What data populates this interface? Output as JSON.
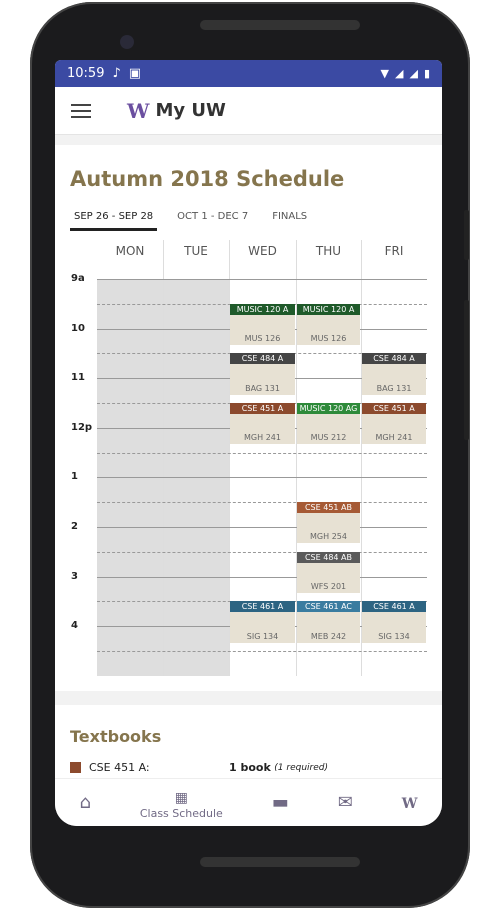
{
  "status": {
    "time": "10:59"
  },
  "app": {
    "title": "My UW",
    "logo": "W"
  },
  "schedule": {
    "title": "Autumn 2018 Schedule",
    "tabs": [
      {
        "label": "SEP 26 - SEP 28",
        "active": true
      },
      {
        "label": "OCT 1 - DEC 7",
        "active": false
      },
      {
        "label": "FINALS",
        "active": false
      }
    ],
    "days": [
      "MON",
      "TUE",
      "WED",
      "THU",
      "FRI"
    ],
    "hours": [
      "9a",
      "10",
      "11",
      "12p",
      "1",
      "2",
      "3",
      "4"
    ],
    "events": [
      {
        "day": 2,
        "start": 9.5,
        "end": 10.33,
        "name": "MUSIC 120 A",
        "loc": "MUS 126",
        "color": "#1f5a2a"
      },
      {
        "day": 3,
        "start": 9.5,
        "end": 10.33,
        "name": "MUSIC 120 A",
        "loc": "MUS 126",
        "color": "#1f5a2a"
      },
      {
        "day": 2,
        "start": 10.5,
        "end": 11.33,
        "name": "CSE 484 A",
        "loc": "BAG 131",
        "color": "#454545"
      },
      {
        "day": 4,
        "start": 10.5,
        "end": 11.33,
        "name": "CSE 484 A",
        "loc": "BAG 131",
        "color": "#454545"
      },
      {
        "day": 2,
        "start": 11.5,
        "end": 12.33,
        "name": "CSE 451 A",
        "loc": "MGH 241",
        "color": "#8c4a2d"
      },
      {
        "day": 3,
        "start": 11.5,
        "end": 12.33,
        "name": "MUSIC 120 AG",
        "loc": "MUS 212",
        "color": "#2e8a3a"
      },
      {
        "day": 4,
        "start": 11.5,
        "end": 12.33,
        "name": "CSE 451 A",
        "loc": "MGH 241",
        "color": "#8c4a2d"
      },
      {
        "day": 3,
        "start": 13.5,
        "end": 14.33,
        "name": "CSE 451 AB",
        "loc": "MGH 254",
        "color": "#a65a35"
      },
      {
        "day": 3,
        "start": 14.5,
        "end": 15.33,
        "name": "CSE 484 AB",
        "loc": "WFS 201",
        "color": "#5a5a5a"
      },
      {
        "day": 2,
        "start": 15.5,
        "end": 16.33,
        "name": "CSE 461 A",
        "loc": "SIG 134",
        "color": "#2d6482"
      },
      {
        "day": 3,
        "start": 15.5,
        "end": 16.33,
        "name": "CSE 461 AC",
        "loc": "MEB 242",
        "color": "#3a7ca0"
      },
      {
        "day": 4,
        "start": 15.5,
        "end": 16.33,
        "name": "CSE 461 A",
        "loc": "SIG 134",
        "color": "#2d6482"
      }
    ]
  },
  "textbooks": {
    "title": "Textbooks",
    "rows": [
      {
        "course": "CSE 451 A:",
        "count": "1 book",
        "note": "(1 required)",
        "color": "#8c4a2d"
      }
    ]
  },
  "nav": {
    "items": [
      {
        "icon": "home-icon"
      },
      {
        "icon": "calendar-icon",
        "label": "Class Schedule"
      },
      {
        "icon": "credit-card-icon"
      },
      {
        "icon": "mail-icon"
      },
      {
        "icon": "uw-icon",
        "glyph": "W"
      }
    ]
  }
}
